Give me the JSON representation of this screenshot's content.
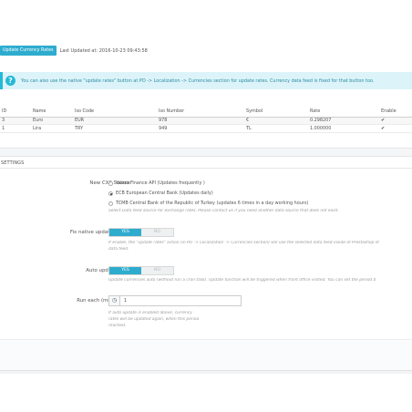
{
  "toolbar": {
    "update_button": "Update Currency Rates",
    "last_updated": "Last Updated at: 2016-10-23 09:43:58"
  },
  "info": {
    "icon": "question-icon",
    "text": "You can also use the native \"update rates\" button at PO -> Localization -> Currencies section for update rates. Currency data feed is fixed for that button too."
  },
  "table": {
    "headers": [
      "ID",
      "Name",
      "Iso Code",
      "Iso Number",
      "Symbol",
      "Rate",
      "Enable"
    ],
    "rows": [
      {
        "id": "3",
        "name": "Euro",
        "iso_code": "EUR",
        "iso_number": "978",
        "symbol": "€",
        "rate": "0.298207",
        "enable": "✔"
      },
      {
        "id": "1",
        "name": "Lira",
        "iso_code": "TRY",
        "iso_number": "949",
        "symbol": "TL",
        "rate": "1.000000",
        "enable": "✔"
      }
    ]
  },
  "settings": {
    "title": "SETTINGS",
    "cxs_label": "New CXS Source",
    "cxs_options": [
      {
        "label": "Yahoo Finance API (Updates frequently )",
        "selected": false
      },
      {
        "label": "ECB European Central Bank (Updates daily)",
        "selected": true
      },
      {
        "label": "TCMB Central Bank of the Republic of Turkey (updates 6 times in a day working hours)",
        "selected": false
      }
    ],
    "cxs_help": "Select Data feed source for exchange rates. Please contact us if you need another data source that does not exist.",
    "fix_label": "Fix native update button",
    "fix_yes": "YES",
    "fix_no": "NO",
    "fix_help_1": "If enable, the \"update rates\" action (in PO -> Localization -> Currencies section) will use the selected data feed inside of Prestashop st",
    "fix_help_2": "data feed.",
    "auto_label": "Auto update rates",
    "auto_yes": "YES",
    "auto_no": "NO",
    "auto_help": "Update currencies auto (without run a cron task). Update function will be triggered when front office visited. You can set the period b",
    "run_label": "Run each (minute(s)):",
    "run_value": "1",
    "run_addon_icon": "clock-icon",
    "run_help_1": "If auto update is enabled above, currency",
    "run_help_2": "rates will be updated again, when this period",
    "run_help_3": "reached."
  },
  "colors": {
    "accent": "#2eacce",
    "info_bg": "#dcf4f9"
  }
}
